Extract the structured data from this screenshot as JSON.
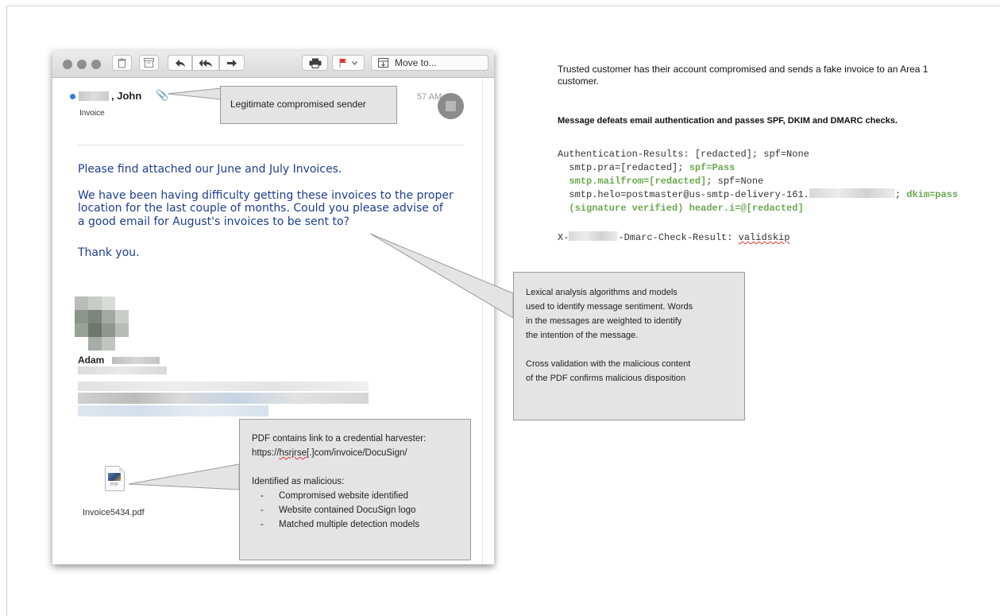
{
  "toolbar": {
    "move_to_label": "Move to..."
  },
  "message": {
    "sender": ", John",
    "subject": "Invoice",
    "time": "57 AM",
    "body": [
      "Please find attached our June and July Invoices.",
      "We have been having difficulty getting these invoices to the proper",
      "location for the last couple of months.  Could you please advise of",
      "a good email for August's invoices to be sent to?",
      "Thank you."
    ],
    "signature_name": "Adam",
    "attachment": {
      "filename": "Invoice5434.pdf",
      "icon_label": "PDF"
    }
  },
  "callouts": {
    "sender": "Legitimate compromised sender",
    "lexical": [
      "Lexical analysis algorithms and models",
      "used to identify message sentiment. Words",
      "in the messages are weighted to identify",
      "the intention of the message.",
      "Cross validation with the malicious content",
      "of the PDF confirms malicious disposition"
    ],
    "pdf": {
      "line1": "PDF contains link to a credential harvester:",
      "url_prefix": "https://",
      "url_domain": "hsrjrse",
      "url_suffix": "[.]com/invoice/DocuSign/",
      "identified": "Identified as malicious:",
      "bullets": [
        "Compromised website identified",
        "Website contained DocuSign logo",
        "Matched multiple detection models"
      ]
    }
  },
  "right": {
    "description": "Trusted customer has their account compromised and sends a fake invoice to an Area 1 customer.",
    "highlight": "Message defeats email authentication and passes SPF, DKIM and DMARC checks.",
    "auth": {
      "line1": "Authentication-Results: [redacted]; spf=None",
      "line2a": "  smtp.pra=[redacted]; ",
      "line2b": "spf=Pass",
      "line3a": "  smtp.mailfrom=[redacted]",
      "line3b": "; spf=None",
      "line4a": "  smtp.helo=postmaster@us-smtp-delivery-161.",
      "line4b": "; ",
      "line4c": "dkim=pass",
      "line5": "  (signature verified) header.i=@[redacted]",
      "dmarc_prefix": "X-",
      "dmarc_middle": "-Dmarc-Check-Result: ",
      "dmarc_value": "validskip"
    }
  },
  "colors": {
    "body_text": "#1d3d8f",
    "green": "#6aa84f",
    "unread": "#2f7de1"
  }
}
